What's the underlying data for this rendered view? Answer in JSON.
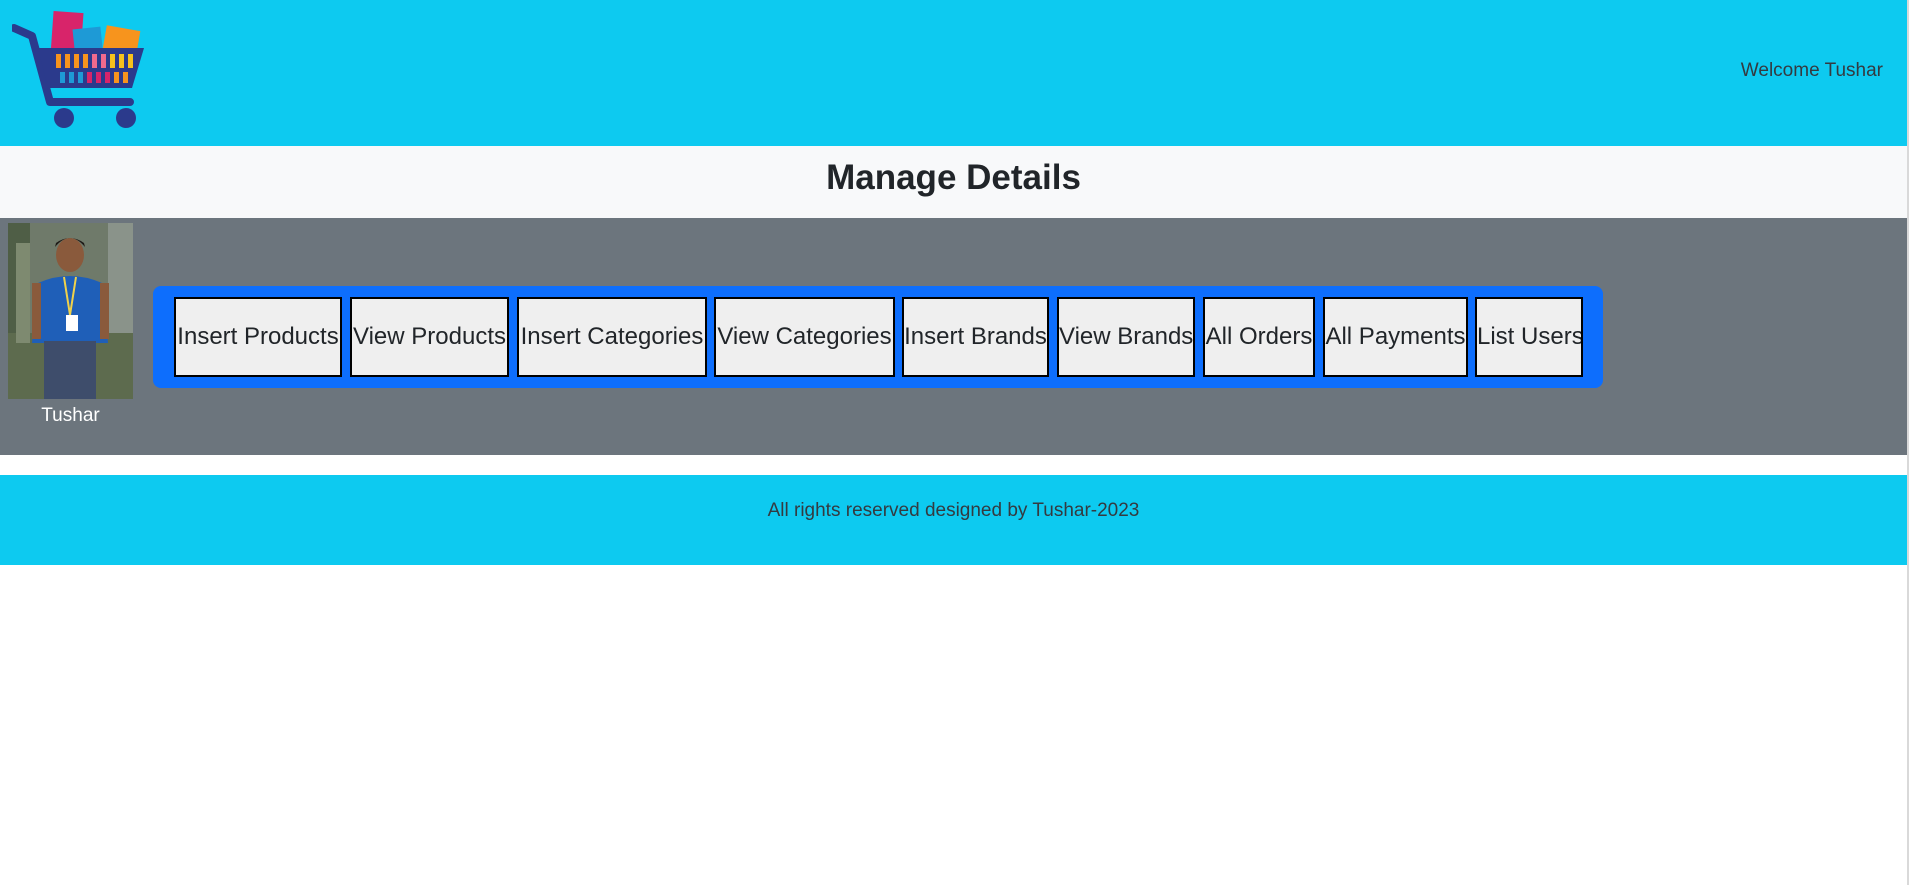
{
  "header": {
    "logo_icon": "shopping-cart-logo-icon",
    "welcome_text": "Welcome Tushar"
  },
  "page": {
    "title": "Manage Details"
  },
  "profile": {
    "name": "Tushar"
  },
  "nav": {
    "buttons": [
      "Insert Products",
      "View Products",
      "Insert Categories",
      "View Categories",
      "Insert Brands",
      "View Brands",
      "All Orders",
      "All Payments",
      "List Users"
    ]
  },
  "footer": {
    "text": "All rights reserved designed by Tushar-2023"
  },
  "colors": {
    "header_bg": "#0dcaf0",
    "title_bg": "#f8f9fa",
    "panel_bg": "#6c757d",
    "nav_box_bg": "#0d6efd",
    "button_bg": "#efefef"
  }
}
